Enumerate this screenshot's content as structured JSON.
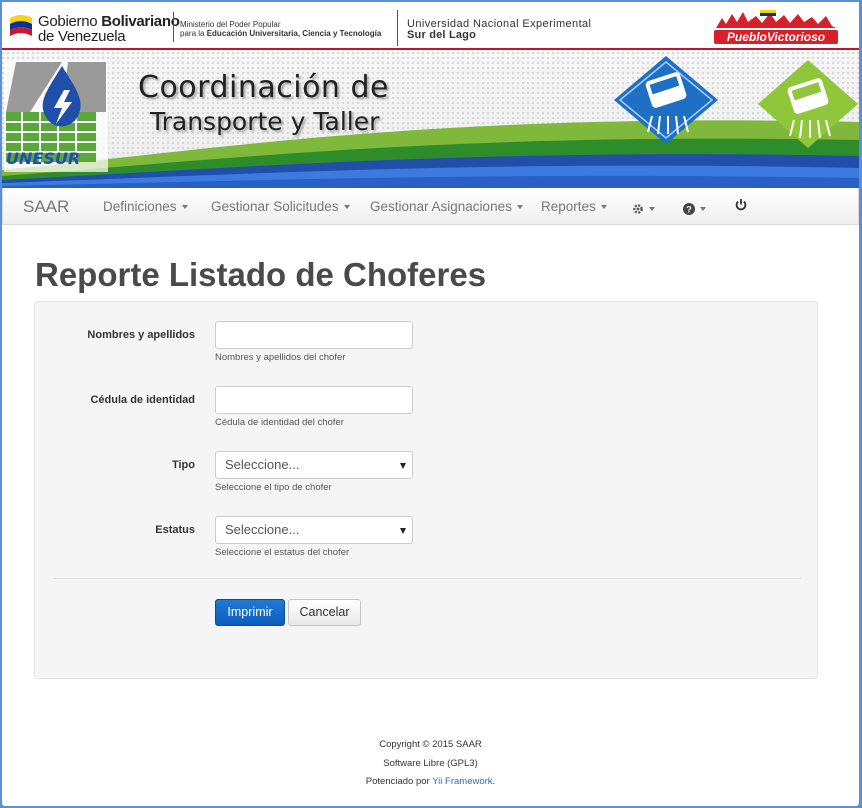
{
  "header": {
    "gov_line1_normal": "Gobierno",
    "gov_line1_bold": "Bolivariano",
    "gov_line2": "de Venezuela",
    "ministry_line1": "Ministerio del Poder Popular",
    "ministry_line2_prefix": "para la",
    "ministry_line2_bold": "Educación Universitaria, Ciencia y Tecnología",
    "univ_line1": "Universidad Nacional Experimental",
    "univ_line2": "Sur del Lago"
  },
  "banner": {
    "title_line1": "Coordinación de",
    "title_line2": "Transporte y Taller"
  },
  "navbar": {
    "brand": "SAAR",
    "items": [
      {
        "label": "Definiciones"
      },
      {
        "label": "Gestionar Solicitudes"
      },
      {
        "label": "Gestionar Asignaciones"
      },
      {
        "label": "Reportes"
      }
    ],
    "icons": [
      "gear-icon",
      "help-icon",
      "power-icon"
    ]
  },
  "page": {
    "title": "Reporte Listado de Choferes"
  },
  "form": {
    "fields": [
      {
        "label": "Nombres y apellidos",
        "value": "",
        "hint": "Nombres y apellidos del chofer",
        "type": "text"
      },
      {
        "label": "Cédula de identidad",
        "value": "",
        "hint": "Cédula de identidad del chofer",
        "type": "text"
      },
      {
        "label": "Tipo",
        "value": "Seleccione...",
        "hint": "Seleccione el tipo de chofer",
        "type": "select"
      },
      {
        "label": "Estatus",
        "value": "Seleccione...",
        "hint": "Seleccione el estatus del chofer",
        "type": "select"
      }
    ],
    "submit_label": "Imprimir",
    "cancel_label": "Cancelar"
  },
  "footer": {
    "copyright": "Copyright © 2015 SAAR",
    "license": "Software Libre (GPL3)",
    "powered_prefix": "Potenciado por",
    "powered_link": "Yii Framework",
    "powered_suffix": "."
  },
  "colors": {
    "primary": "#0b5dbd",
    "gov_red": "#c8102e",
    "outer_frame": "#5b8fd6"
  }
}
